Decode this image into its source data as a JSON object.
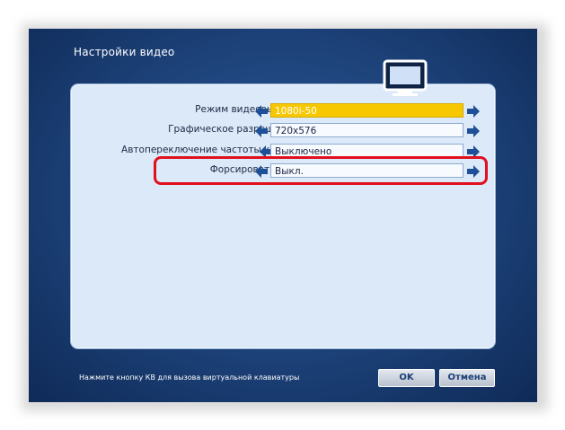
{
  "window": {
    "title": "Настройки видео"
  },
  "settings": [
    {
      "label": "Режим видеовыхода:",
      "value": "1080i-50",
      "active": true
    },
    {
      "label": "Графическое разрешение:",
      "value": "720x576",
      "active": false
    },
    {
      "label": "Автопереключение частоты кадров:",
      "value": "Выключено",
      "active": false
    },
    {
      "label": "Форсировать DVI",
      "value": "Выкл.",
      "active": false,
      "highlighted": true
    }
  ],
  "footer": {
    "hint": "Нажмите кнопку КВ для вызова виртуальной клавиатуры",
    "ok_label": "OK",
    "cancel_label": "Отмена"
  },
  "icons": {
    "header": "monitor-icon",
    "prev": "arrow-left-icon",
    "next": "arrow-right-icon"
  },
  "colors": {
    "background": "#1c4178",
    "panel": "#dbe9f9",
    "selected": "#f7c800",
    "highlight": "#e0101e",
    "button_text": "#1c3f77"
  }
}
